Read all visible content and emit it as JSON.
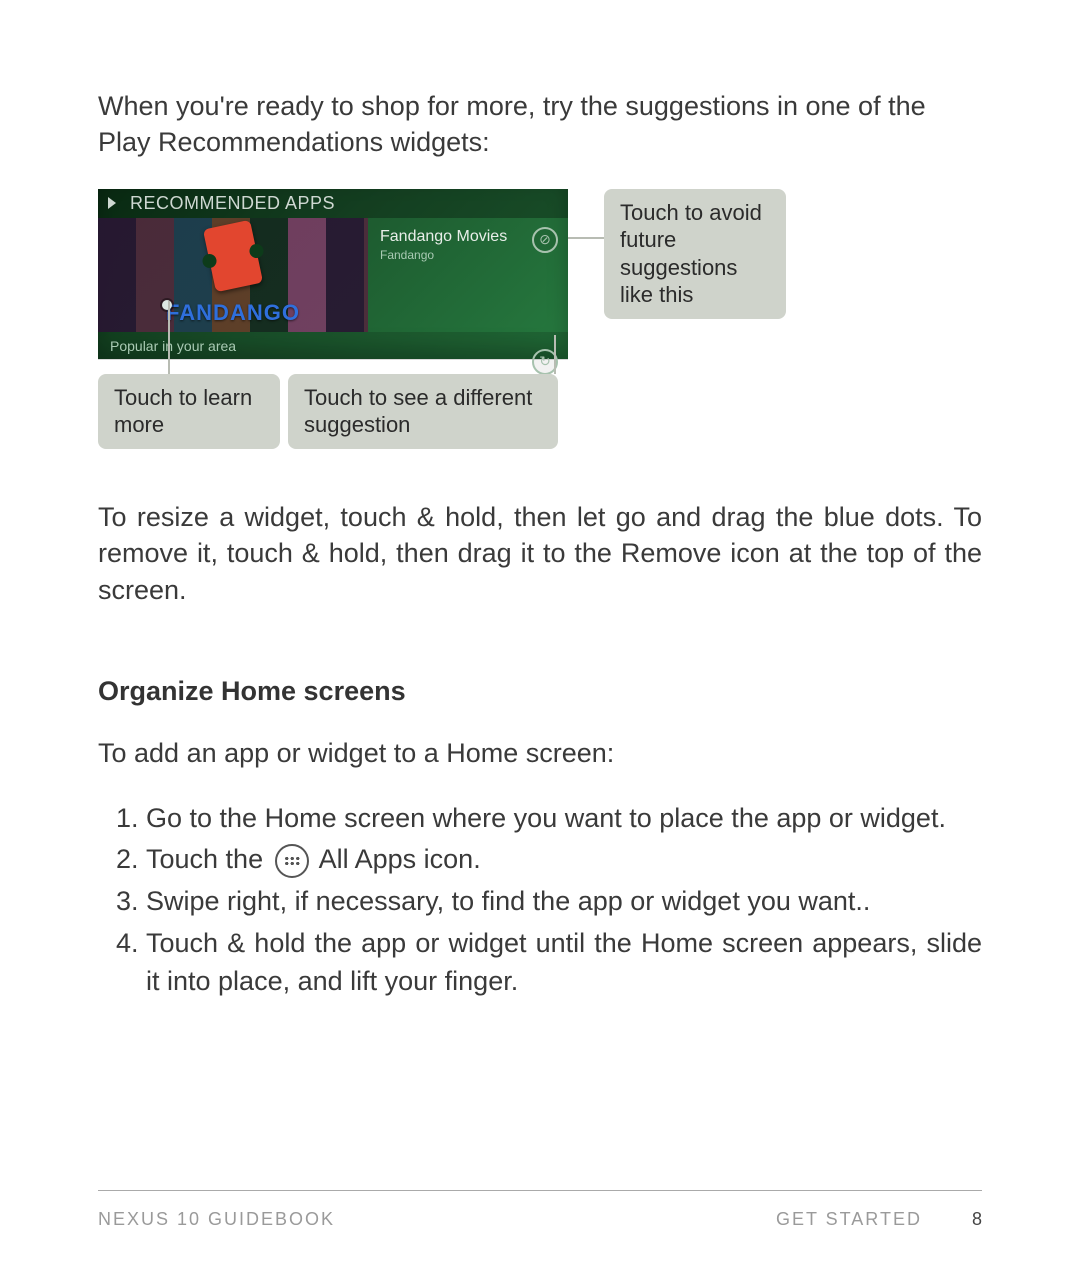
{
  "intro": "When you're ready to shop for more, try the suggestions in one of the Play Recommendations widgets:",
  "widget": {
    "header": "RECOMMENDED APPS",
    "brand": "FANDANGO",
    "title": "Fandango Movies",
    "publisher": "Fandango",
    "footer": "Popular in your area"
  },
  "callouts": {
    "learn": "Touch to learn more",
    "different": "Touch to see a different suggestion",
    "avoid": "Touch to avoid future suggestions like this"
  },
  "resize_text": "To resize a widget, touch & hold, then let go and drag the blue dots. To remove it, touch & hold, then drag it to the Remove icon at the top of the screen.",
  "section_title": "Organize Home screens",
  "section_intro": "To add an app or widget to a Home screen:",
  "steps": {
    "s1": "Go to the Home screen where you want to place the app or widget.",
    "s2a": "Touch the ",
    "s2b": " All Apps icon.",
    "s3": "Swipe right, if necessary, to find the app or widget you want..",
    "s4": "Touch & hold the app or widget until the Home screen appears, slide it into place, and lift your finger."
  },
  "footer": {
    "left": "NEXUS 10 GUIDEBOOK",
    "right": "GET STARTED",
    "page": "8"
  }
}
